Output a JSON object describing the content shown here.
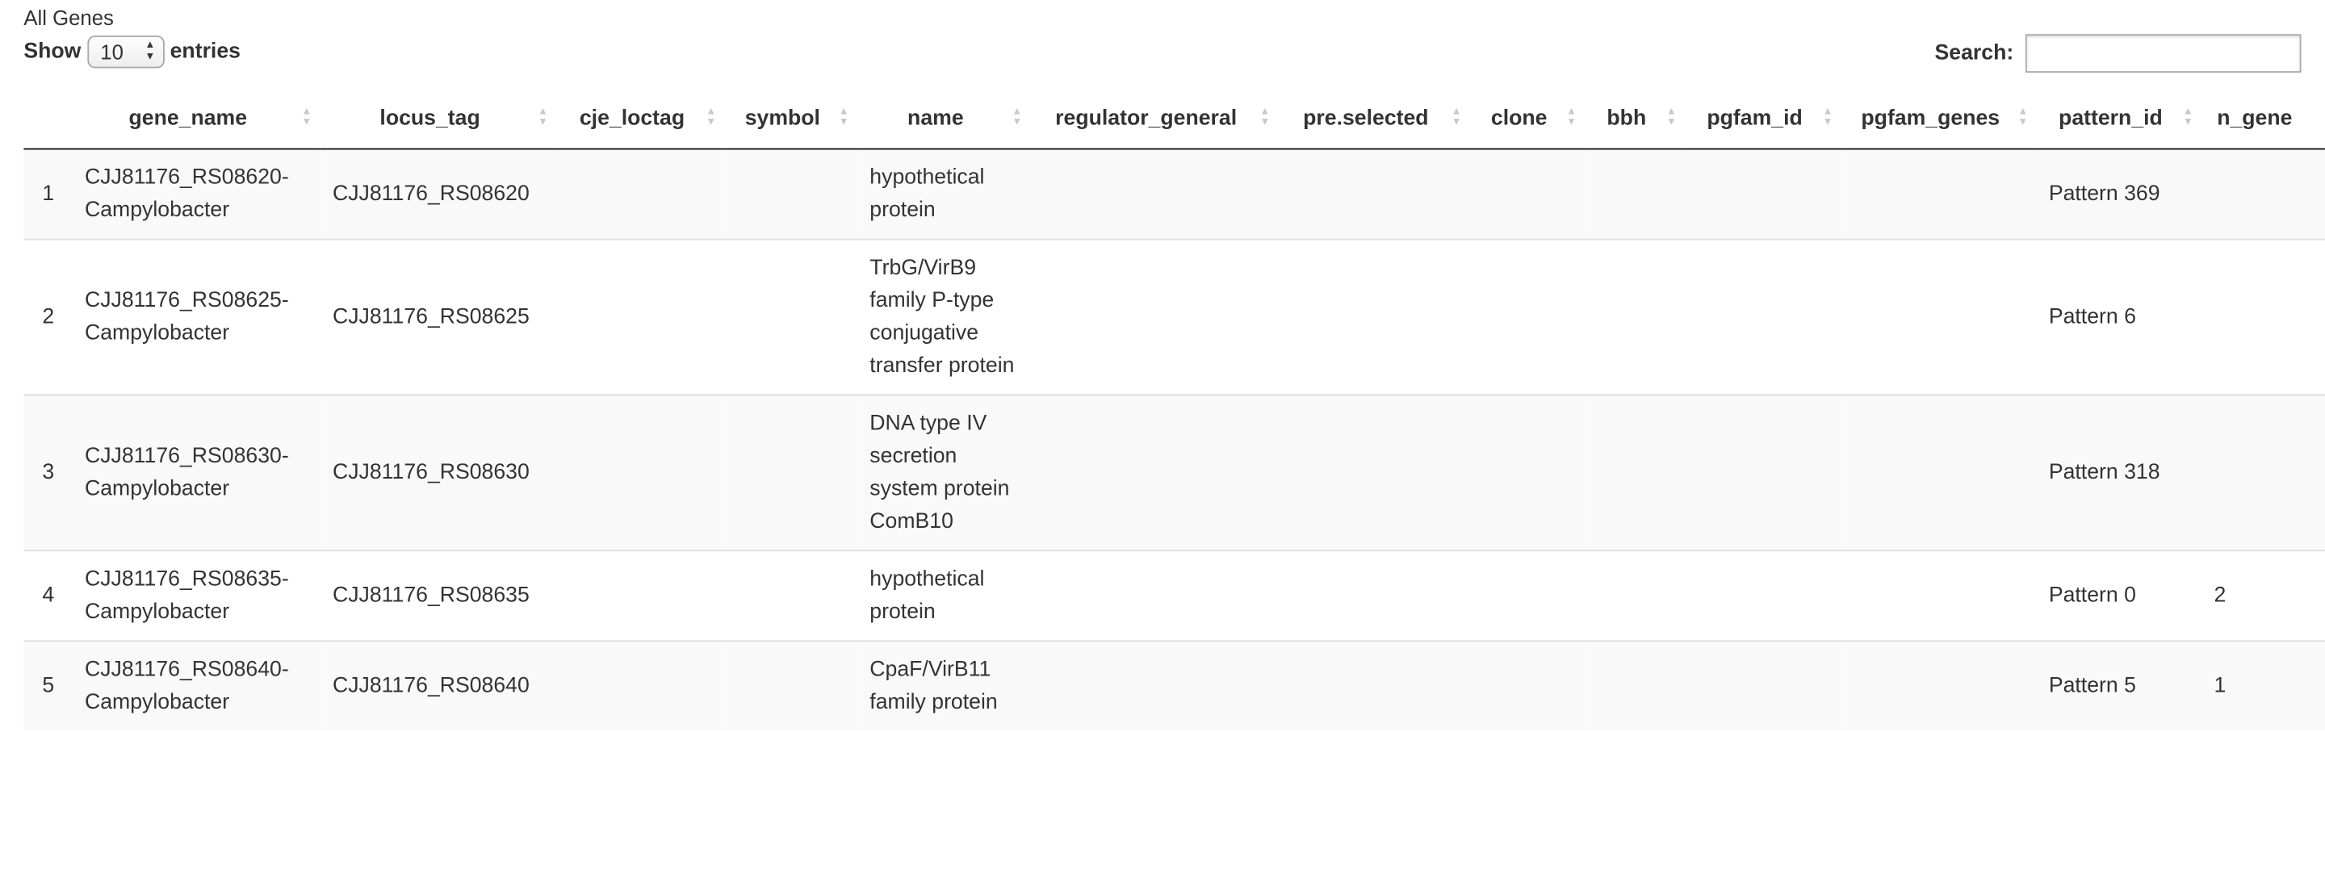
{
  "page_title": "All Genes",
  "length_control": {
    "show_label": "Show",
    "value": "10",
    "entries_label": "entries"
  },
  "search": {
    "label": "Search:",
    "value": ""
  },
  "columns": [
    {
      "key": "index",
      "label": ""
    },
    {
      "key": "gene_name",
      "label": "gene_name"
    },
    {
      "key": "locus_tag",
      "label": "locus_tag"
    },
    {
      "key": "cje_loctag",
      "label": "cje_loctag"
    },
    {
      "key": "symbol",
      "label": "symbol"
    },
    {
      "key": "name",
      "label": "name"
    },
    {
      "key": "regulator_general",
      "label": "regulator_general"
    },
    {
      "key": "pre_selected",
      "label": "pre.selected"
    },
    {
      "key": "clone",
      "label": "clone"
    },
    {
      "key": "bbh",
      "label": "bbh"
    },
    {
      "key": "pgfam_id",
      "label": "pgfam_id"
    },
    {
      "key": "pgfam_genes",
      "label": "pgfam_genes"
    },
    {
      "key": "pattern_id",
      "label": "pattern_id"
    },
    {
      "key": "n_genes",
      "label": "n_gene"
    }
  ],
  "rows": [
    {
      "index": "1",
      "gene_name": "CJJ81176_RS08620-Campylobacter",
      "locus_tag": "CJJ81176_RS08620",
      "cje_loctag": "",
      "symbol": "",
      "name": "hypothetical protein",
      "regulator_general": "",
      "pre_selected": "",
      "clone": "",
      "bbh": "",
      "pgfam_id": "",
      "pgfam_genes": "",
      "pattern_id": "Pattern 369",
      "n_genes": ""
    },
    {
      "index": "2",
      "gene_name": "CJJ81176_RS08625-Campylobacter",
      "locus_tag": "CJJ81176_RS08625",
      "cje_loctag": "",
      "symbol": "",
      "name": "TrbG/VirB9 family P-type conjugative transfer protein",
      "regulator_general": "",
      "pre_selected": "",
      "clone": "",
      "bbh": "",
      "pgfam_id": "",
      "pgfam_genes": "",
      "pattern_id": "Pattern 6",
      "n_genes": ""
    },
    {
      "index": "3",
      "gene_name": "CJJ81176_RS08630-Campylobacter",
      "locus_tag": "CJJ81176_RS08630",
      "cje_loctag": "",
      "symbol": "",
      "name": "DNA type IV secretion system protein ComB10",
      "regulator_general": "",
      "pre_selected": "",
      "clone": "",
      "bbh": "",
      "pgfam_id": "",
      "pgfam_genes": "",
      "pattern_id": "Pattern 318",
      "n_genes": ""
    },
    {
      "index": "4",
      "gene_name": "CJJ81176_RS08635-Campylobacter",
      "locus_tag": "CJJ81176_RS08635",
      "cje_loctag": "",
      "symbol": "",
      "name": "hypothetical protein",
      "regulator_general": "",
      "pre_selected": "",
      "clone": "",
      "bbh": "",
      "pgfam_id": "",
      "pgfam_genes": "",
      "pattern_id": "Pattern 0",
      "n_genes": "2"
    },
    {
      "index": "5",
      "gene_name": "CJJ81176_RS08640-Campylobacter",
      "locus_tag": "CJJ81176_RS08640",
      "cje_loctag": "",
      "symbol": "",
      "name": "CpaF/VirB11 family protein",
      "regulator_general": "",
      "pre_selected": "",
      "clone": "",
      "bbh": "",
      "pgfam_id": "",
      "pgfam_genes": "",
      "pattern_id": "Pattern 5",
      "n_genes": "1"
    }
  ],
  "icons": {
    "sort": "sort-both-icon",
    "select_arrows": "select-arrows-icon"
  },
  "colors": {
    "text": "#333333",
    "stripe": "#f9f9f9",
    "header_rule": "#111111",
    "row_border": "#dddddd",
    "sort_icon": "#c8c8c8"
  }
}
